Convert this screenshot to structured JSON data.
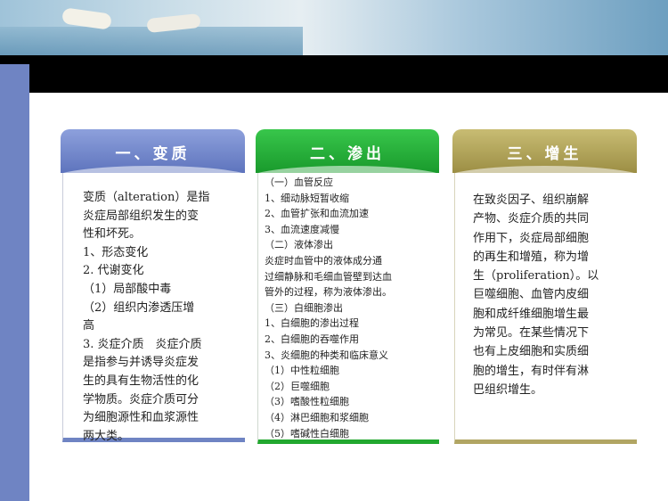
{
  "col1": {
    "tab": "一、变质",
    "lines": [
      "变质（alteration）是指",
      "炎症局部组织发生的变",
      "性和坏死。",
      "1、形态变化",
      "2. 代谢变化",
      "（1）局部酸中毒",
      "（2）组织内渗透压增",
      "高",
      "3. 炎症介质　炎症介质",
      "是指参与并诱导炎症发",
      "生的具有生物活性的化",
      "学物质。炎症介质可分",
      "为细胞源性和血浆源性",
      "两大类。"
    ]
  },
  "col2": {
    "tab": "二、渗出",
    "lines": [
      "（一）血管反应",
      "1、细动脉短暂收缩",
      "2、血管扩张和血流加速",
      " 3、血流速度减慢",
      "（二）液体渗出",
      " 炎症时血管中的液体成分通",
      "过细静脉和毛细血管壁到达血",
      "管外的过程，称为液体渗出。",
      "（三）白细胞渗出",
      "1、白细胞的渗出过程",
      "2、白细胞的吞噬作用",
      "3、炎细胞的种类和临床意义",
      "（1）中性粒细胞",
      "（2）巨噬细胞",
      "（3）嗜酸性粒细胞",
      "（4）淋巴细胞和浆细胞",
      "（5）嗜碱性白细胞"
    ]
  },
  "col3": {
    "tab": "三、增生",
    "lines": [
      "在致炎因子、组织崩解",
      "产物、炎症介质的共同",
      "作用下，炎症局部细胞",
      "的再生和增殖，称为增",
      "生（proliferation）。以",
      "巨噬细胞、血管内皮细",
      "胞和成纤维细胞增生最",
      "为常见。在某些情况下",
      "也有上皮细胞和实质细",
      "胞的增生，有时伴有淋",
      "巴组织增生。"
    ]
  }
}
